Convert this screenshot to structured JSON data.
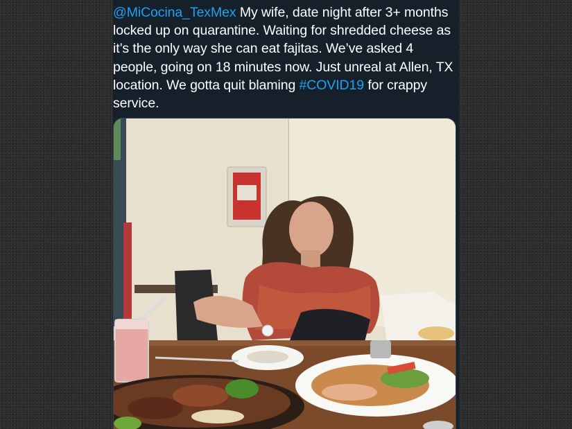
{
  "tweet": {
    "mention": "@MiCocina_TexMex",
    "text_part1": " My wife, date night after 3+ months locked up on quarantine. Waiting for shredded cheese as it’s the only way she can eat fajitas. We’ve asked 4 people, going on 18 minutes now. Just unreal at Allen, TX location. We gotta quit blaming ",
    "hashtag": "#COVID19",
    "text_part2": " for crappy service."
  },
  "colors": {
    "background": "#2b2b2b",
    "card": "#15202b",
    "text": "#ffffff",
    "link": "#1da1f2"
  }
}
